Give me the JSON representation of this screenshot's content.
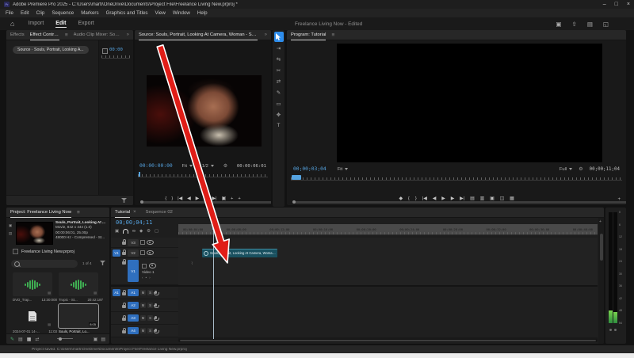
{
  "colors": {
    "accent_blue": "#2d8ceb",
    "timecode_blue": "#55a3e0",
    "clip_teal": "#19505f",
    "arrow_red": "#e01d17",
    "meter_green": "#3fae52",
    "track_target_blue": "#2f6fbe"
  },
  "icons": {
    "minimize": "–",
    "maximize": "□",
    "close": "×",
    "home": "⌂",
    "overflow": "»",
    "panel_menu": "≡",
    "close_tab": "×",
    "brace_open": "{",
    "brace_close": "}",
    "marker": "◆",
    "step_back": "|◀",
    "prev_frame": "◀",
    "play": "▶",
    "next_frame": "▶",
    "step_fwd": "▶|",
    "export_frame": "▣",
    "plus": "+",
    "gear": "⚙",
    "lift": "▤",
    "extract": "▥",
    "compare": "◫",
    "multi": "▦",
    "nest": "▣",
    "link_selection": "∞",
    "add_marker": "◆",
    "settings_box": "▢",
    "pencil": "✎",
    "list_view": "▤",
    "grid_view": "▦",
    "shuffle": "⇄",
    "new_bin": "▣",
    "new_item": "▤",
    "camera_side": "▣",
    "film_side": "▤",
    "track_select": "⇥",
    "ripple_edit": "⇆",
    "razor": "✂",
    "slip": "⇄",
    "pen": "✎",
    "rect": "▭",
    "hand": "✥",
    "type": "T",
    "workspaces": "▣",
    "quick_export": "⇧",
    "progress": "▤",
    "fullscreen": "◱",
    "nav_left": "‹",
    "nav_dot": "•",
    "nav_right": "›",
    "mute": "M",
    "solo": "S"
  },
  "title_bar": {
    "app_badge": "Pr",
    "title": "Adobe Premiere Pro 2025 - C:\\Users\\marti\\OneDrive\\Documents\\Project File\\Freelance Living New.prproj *"
  },
  "menu_bar": {
    "items": [
      "File",
      "Edit",
      "Clip",
      "Sequence",
      "Markers",
      "Graphics and Titles",
      "View",
      "Window",
      "Help"
    ]
  },
  "workspace": {
    "tabs": {
      "import": "Import",
      "edit": "Edit",
      "export": "Export"
    },
    "doc_title": "Freelance Living Now - Edited"
  },
  "effect_controls": {
    "tab_effects": "Effects",
    "tab_effect_controls": "Effect Controls",
    "tab_audio_mixer": "Audio Clip Mixer: Souls, Portrait, Look",
    "clip_selector": "Source · Souls, Portrait, Looking A...",
    "timecode": "00:00"
  },
  "source_monitor": {
    "tab": "Source: Souls, Portrait, Looking At Camera, Woman - Stock Video Footage - Ar",
    "timecode": "00:00:00:00",
    "zoom_level": "Fit",
    "playback_res": "1/2",
    "duration": "00:00:06:01"
  },
  "program_monitor": {
    "tab": "Program: Tutorial",
    "timecode": "00;00;03;04",
    "zoom_level": "Fit",
    "playback_res": "Full",
    "duration": "00;00;11;04"
  },
  "project_panel": {
    "tab": "Project: Freelance Living Now",
    "preview": {
      "line1": "Souls, Portrait, Looking At ...",
      "line2": "Movie, 842 x 444 (1.0)",
      "line3": "00:00:06:01, 25.00p",
      "line4": "48000 Hz - Compressed - St..."
    },
    "bin": "Freelance Living New.prproj",
    "result_count": "1 of 4",
    "items": [
      {
        "name": "DVD_Trap...",
        "meta": "13:30:000"
      },
      {
        "name": "Tropic - St...",
        "meta": "20:42:187"
      },
      {
        "name": "2024-07-01 14-...",
        "meta": "11:03"
      },
      {
        "name": "Souls, Portrait, Lo...",
        "meta": "8:05"
      }
    ]
  },
  "timeline": {
    "tab_active": "Tutorial",
    "tab_inactive": "Sequence 02",
    "timecode": "00;00;04;11",
    "ruler_labels": [
      "00;00;04;00",
      "00;00;08;00",
      "00;00;12;00",
      "00;00;16;00",
      "00;00;20;00",
      "00;00;24;00",
      "00;00;28;00",
      "00;00;32;00",
      "00;00;36;00",
      "00;00;40;00"
    ],
    "video_tracks": [
      {
        "label": "V3"
      },
      {
        "label": "V2"
      },
      {
        "label": "V1",
        "name": "Video 1"
      }
    ],
    "audio_tracks": [
      "A1",
      "A2",
      "A3",
      "A4"
    ],
    "source_patch_video": "V1",
    "source_patch_audio": "A1",
    "clip_label": "Souls, Portrait, Looking At Camera, Woman - Stock Vi"
  },
  "audio_meters": {
    "ticks": [
      "0",
      "6",
      "12",
      "18",
      "24",
      "30",
      "36",
      "42",
      "48",
      "54"
    ]
  },
  "status_bar": {
    "text": "Project saved. C:\\Users\\marti\\OneDrive\\Documents\\Project File\\Freelance Living New.prproj"
  }
}
